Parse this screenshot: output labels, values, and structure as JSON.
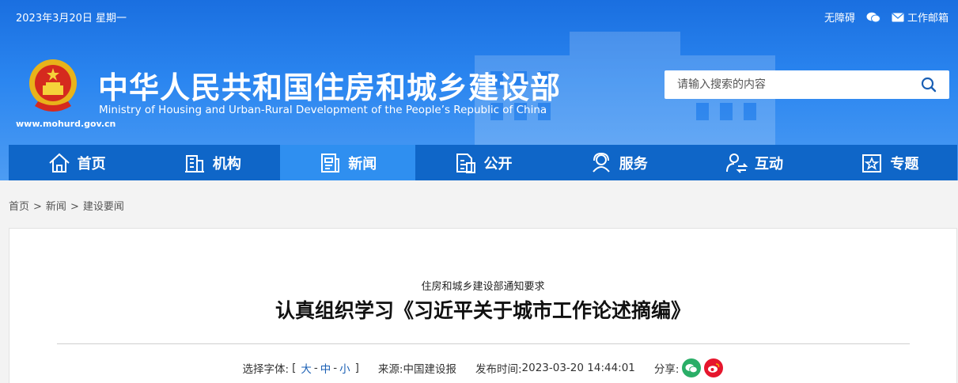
{
  "topbar": {
    "date": "2023年3月20日 星期一",
    "accessibility": "无障碍",
    "mail": "工作邮箱"
  },
  "header": {
    "title_cn": "中华人民共和国住房和城乡建设部",
    "title_en": "Ministry of Housing and Urban-Rural Development of the People’s Republic of China",
    "site_url": "www.mohurd.gov.cn"
  },
  "search": {
    "placeholder": "请输入搜索的内容"
  },
  "nav": {
    "items": [
      {
        "label": "首页",
        "icon": "home-icon"
      },
      {
        "label": "机构",
        "icon": "building-icon"
      },
      {
        "label": "新闻",
        "icon": "news-icon",
        "active": true
      },
      {
        "label": "公开",
        "icon": "document-icon"
      },
      {
        "label": "服务",
        "icon": "service-icon"
      },
      {
        "label": "互动",
        "icon": "interaction-icon"
      },
      {
        "label": "专题",
        "icon": "star-icon"
      }
    ]
  },
  "breadcrumb": {
    "home": "首页",
    "news": "新闻",
    "current": "建设要闻",
    "sep": ">"
  },
  "article": {
    "subtitle": "住房和城乡建设部通知要求",
    "title": "认真组织学习《习近平关于城市工作论述摘编》",
    "font_label": "选择字体:",
    "font_open": "[",
    "font_large": "大",
    "font_medium": "中",
    "font_small": "小",
    "font_dash": "-",
    "font_close": "]",
    "source_label": "来源:",
    "source": "中国建设报",
    "time_label": "发布时间:",
    "time": "2023-03-20 14:44:01",
    "share_label": "分享:"
  },
  "colors": {
    "nav_bg": "#0f66c8",
    "nav_active": "#2f8ff0",
    "link": "#1a5fb4",
    "wechat": "#2aae67",
    "weibo": "#e6162d"
  }
}
